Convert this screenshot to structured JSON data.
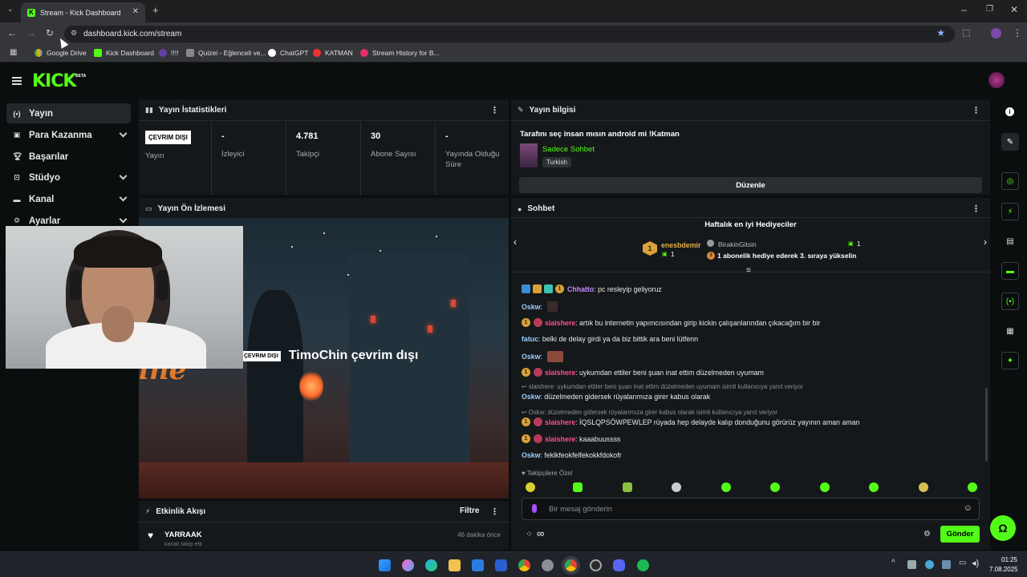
{
  "browser": {
    "tab_title": "Stream - Kick Dashboard",
    "url": "dashboard.kick.com/stream",
    "bookmarks": [
      "Google Drive",
      "Kick Dashboard",
      "!!!!",
      "Quizei - Eğlenceli ve...",
      "ChatGPT",
      "KATMAN",
      "Stream History for B..."
    ]
  },
  "app": {
    "logo": "KICK",
    "beta": "BETA"
  },
  "sidebar": {
    "items": [
      {
        "label": "Yayın"
      },
      {
        "label": "Para Kazanma"
      },
      {
        "label": "Başarılar"
      },
      {
        "label": "Stüdyo"
      },
      {
        "label": "Kanal"
      },
      {
        "label": "Ayarlar"
      }
    ]
  },
  "stats": {
    "title": "Yayın İstatistikleri",
    "offline_badge": "ÇEVRIM DIŞI",
    "cells": [
      {
        "value": "",
        "label": "Yayın"
      },
      {
        "value": "-",
        "label": "İzleyici"
      },
      {
        "value": "4.781",
        "label": "Takipçi"
      },
      {
        "value": "30",
        "label": "Abone Sayısı"
      },
      {
        "value": "-",
        "label": "Yayında Olduğu Süre"
      }
    ]
  },
  "preview": {
    "title": "Yayın Ön İzlemesi",
    "badge": "ÇEVRIM DIŞI",
    "offline_text": "TimoChin çevrim dışı",
    "art_text": "ine"
  },
  "events": {
    "title": "Etkinlik Akışı",
    "filter": "Filtre",
    "item_name": "YARRAAK",
    "item_sub": "kanalı takip etti",
    "item_time": "46 dakika önce"
  },
  "stream_info": {
    "title": "Yayın bilgisi",
    "stream_title": "Tarafını seç insan mısın android mi !Katman",
    "category": "Sadece Sohbet",
    "language": "Turkish",
    "edit_button": "Düzenle"
  },
  "chat": {
    "title": "Sohbet",
    "gifters_title": "Haftalık en iyi Hediyeciler",
    "gifter1": {
      "name": "enesbdemir",
      "count": "1",
      "rank": "1"
    },
    "gifter2": {
      "name": "BirakinGitsin",
      "count": "1",
      "note": "1 abonelik hediye ederek 3. sıraya yükselin",
      "rank": "3"
    },
    "messages": [
      {
        "user": "Chhatto",
        "color": "#c58cff",
        "text": ": pc resleyip geliyoruz"
      },
      {
        "user": "Oskw",
        "color": "#9bd0ff",
        "text": ":"
      },
      {
        "user": "slaishere",
        "color": "#ff4f8b",
        "text": ": artık bu internetin yapımcısından girip kickin çalışanlarından çıkacağım bir bir"
      },
      {
        "user": "fatuc",
        "color": "#9bd0ff",
        "text": ": belki de delay girdi ya da biz bittik ara beni lütfenn"
      },
      {
        "user": "Oskw",
        "color": "#9bd0ff",
        "text": ":"
      },
      {
        "user": "slaishere",
        "color": "#ff4f8b",
        "text": ": uykumdan ettiler beni şuan inat ettim düzelmeden uyumam"
      },
      {
        "user": "Oskw",
        "color": "#9bd0ff",
        "text": ": düzelmeden gidersek rüyalarımıza girer kabus olarak"
      },
      {
        "user": "slaishere",
        "color": "#ff4f8b",
        "text": ": İQSLQPSÖWPEWLEP rüyada hep delayde kalıp donduğunu görürüz yayının aman aman"
      },
      {
        "user": "slaishere",
        "color": "#ff4f8b",
        "text": ": kaaabuussss"
      },
      {
        "user": "Oskw",
        "color": "#9bd0ff",
        "text": ": feklkfeokfelfekokkfdokofr"
      }
    ],
    "reply1": "slaishere: uykumdan ettiler beni şuan inat ettim düzelmeden uyumam isimli kullanıcıya yanıt veriyor",
    "reply2": "Oskw: düzelmeden gidersek rüyalarımıza girer kabus olarak isimli kullanıcıya yanıt veriyor",
    "followers_only": "Takipçilere Özel",
    "input_placeholder": "Bir mesaj gönderin",
    "send_button": "Gönder"
  },
  "taskbar": {
    "time": "01:25",
    "date": "7.08.2025"
  },
  "colors": {
    "brand": "#53fc18",
    "panel": "#15181a",
    "bg": "#0b0e0f"
  }
}
